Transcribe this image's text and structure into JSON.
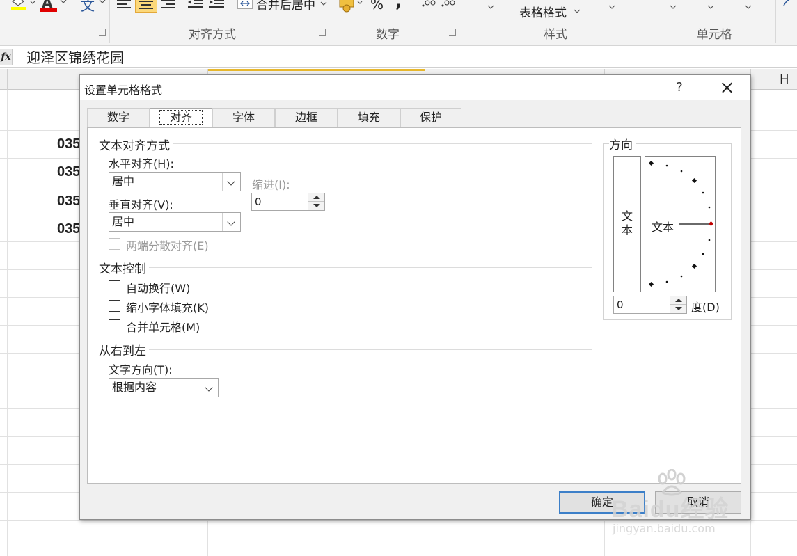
{
  "ribbon": {
    "groups": [
      {
        "label": "对齐方式"
      },
      {
        "label": "数字"
      },
      {
        "label": "样式"
      },
      {
        "label": "单元格"
      }
    ],
    "merge_center_label": "合并后居中",
    "table_format_label": "表格格式",
    "percent_symbol": "%",
    "comma_symbol": ",",
    "font_color_letter": "A",
    "phonetic_char": "文"
  },
  "formula_bar": {
    "fx_label": "fx",
    "value": "迎泽区锦绣花园"
  },
  "sheet": {
    "column_h_label": "H",
    "cell_values": [
      "035",
      "035",
      "035",
      "035"
    ]
  },
  "dialog": {
    "title": "设置单元格格式",
    "help_symbol": "?",
    "tabs": [
      {
        "label": "数字",
        "active": false
      },
      {
        "label": "对齐",
        "active": true
      },
      {
        "label": "字体",
        "active": false
      },
      {
        "label": "边框",
        "active": false
      },
      {
        "label": "填充",
        "active": false
      },
      {
        "label": "保护",
        "active": false
      }
    ],
    "text_alignment": {
      "section_label": "文本对齐方式",
      "horizontal_label": "水平对齐(H):",
      "horizontal_value": "居中",
      "vertical_label": "垂直对齐(V):",
      "vertical_value": "居中",
      "indent_label": "缩进(I):",
      "indent_value": "0",
      "justify_distributed_label": "两端分散对齐(E)"
    },
    "text_control": {
      "section_label": "文本控制",
      "wrap_text_label": "自动换行(W)",
      "wrap_text_checked": false,
      "shrink_to_fit_label": "缩小字体填充(K)",
      "shrink_to_fit_checked": false,
      "merge_cells_label": "合并单元格(M)",
      "merge_cells_checked": false
    },
    "right_to_left": {
      "section_label": "从右到左",
      "direction_label": "文字方向(T):",
      "direction_value": "根据内容"
    },
    "orientation": {
      "section_label": "方向",
      "vertical_text": "文本",
      "dial_text": "文本",
      "degree_value": "0",
      "degree_label": "度(D)"
    },
    "ok_label": "确定",
    "cancel_label": "取消"
  },
  "watermark": {
    "main": "Baidu经验",
    "sub": "jingyan.baidu.com"
  },
  "colors": {
    "accent_blue": "#3c7fc8",
    "selected_column": "#e7b72d",
    "active_align_button": "#fcd87a",
    "dial_indicator": "#c00000"
  }
}
